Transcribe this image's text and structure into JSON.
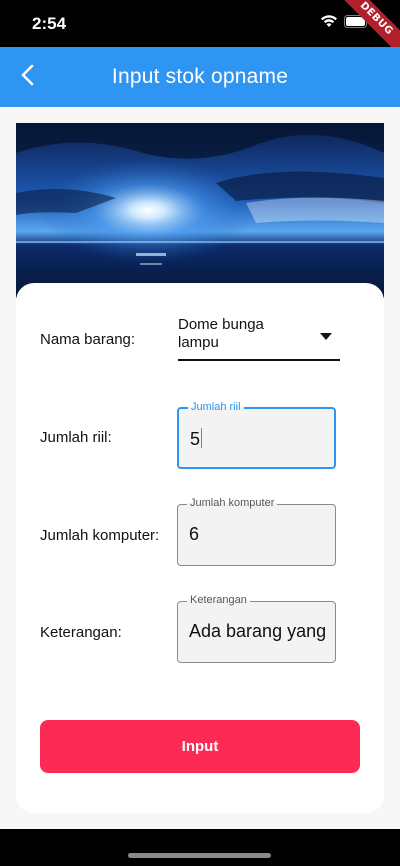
{
  "status": {
    "time": "2:54",
    "debug_label": "DEBUG"
  },
  "app_bar": {
    "title": "Input stok opname"
  },
  "form": {
    "nama_barang_label": "Nama barang:",
    "nama_barang_value": "Dome bunga lampu",
    "jumlah_riil_label": "Jumlah riil:",
    "jumlah_riil_legend": "Jumlah riil",
    "jumlah_riil_value": "5",
    "jumlah_komputer_label": "Jumlah komputer:",
    "jumlah_komputer_legend": "Jumlah komputer",
    "jumlah_komputer_value": "6",
    "keterangan_label": "Keterangan:",
    "keterangan_legend": "Keterangan",
    "keterangan_value": "Ada barang yang",
    "submit_label": "Input"
  },
  "colors": {
    "app_bar": "#2f95f2",
    "submit": "#fb2b55",
    "focus": "#2f95f2"
  },
  "icons": [
    "wifi-icon",
    "battery-icon",
    "back-arrow-icon",
    "dropdown-arrow-icon"
  ]
}
